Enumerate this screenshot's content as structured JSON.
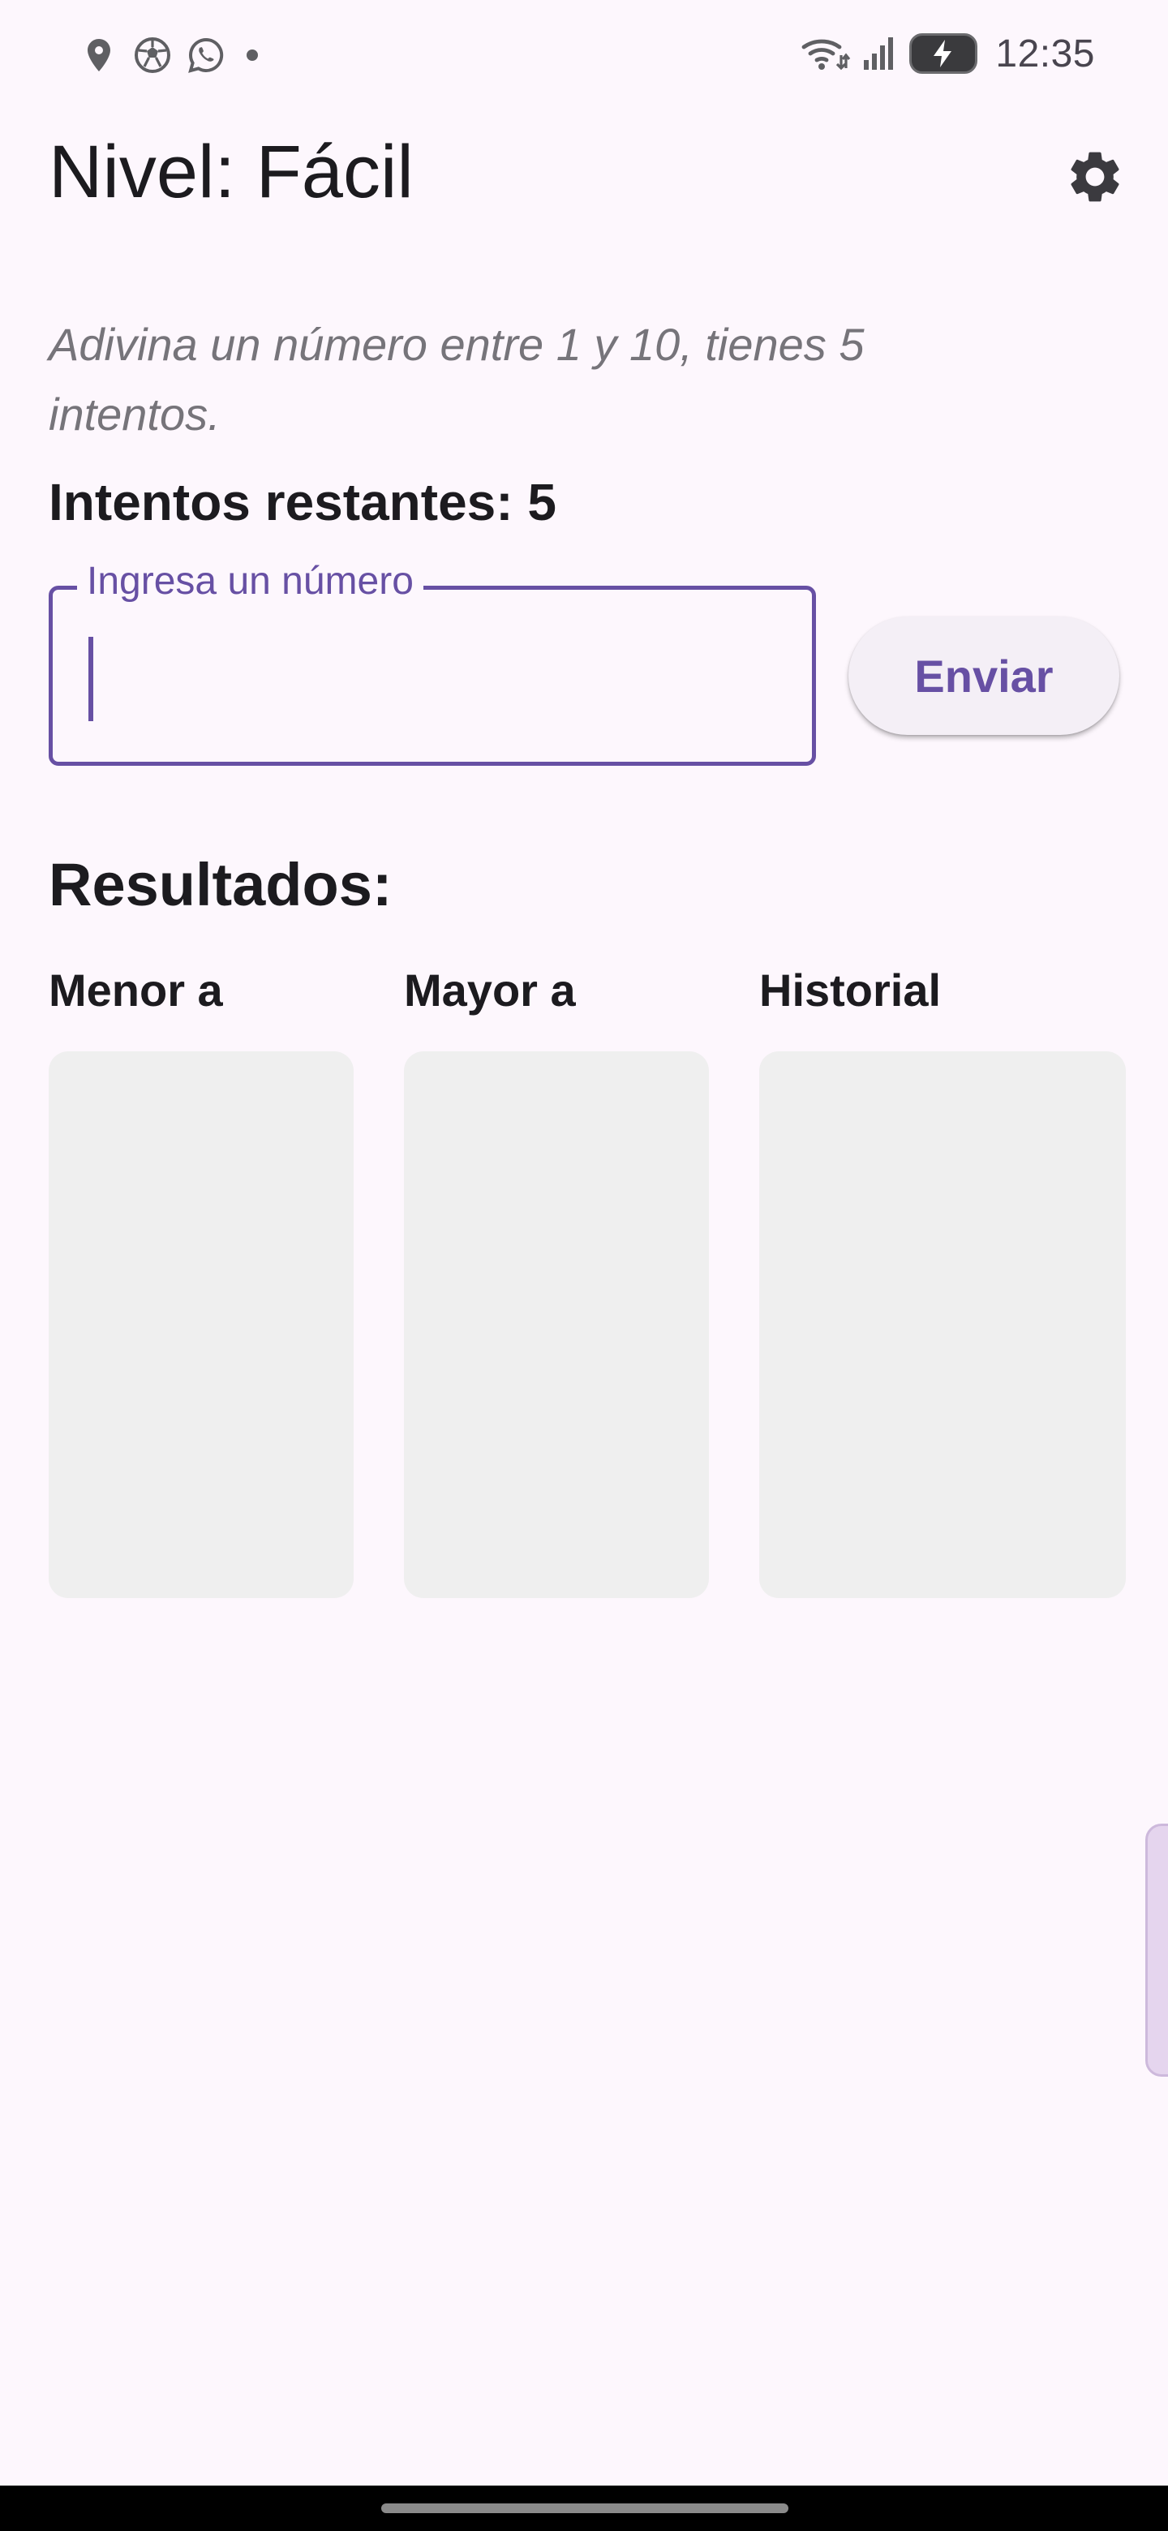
{
  "status_bar": {
    "time": "12:35",
    "left_icons": [
      "location-icon",
      "soccer-ball-icon",
      "whatsapp-icon",
      "notification-dot-icon"
    ],
    "right_icons": [
      "wifi-icon",
      "signal-icon",
      "battery-charging-icon"
    ]
  },
  "header": {
    "title": "Nivel: Fácil",
    "settings_icon": "gear-icon"
  },
  "game": {
    "instructions": "Adivina un número entre 1 y 10, tienes 5 intentos.",
    "attempts_label": "Intentos restantes: 5"
  },
  "input": {
    "label": "Ingresa un número",
    "value": ""
  },
  "send_button": {
    "label": "Enviar"
  },
  "results": {
    "heading": "Resultados:",
    "columns": [
      {
        "label": "Menor a"
      },
      {
        "label": "Mayor a"
      },
      {
        "label": "Historial"
      }
    ]
  },
  "colors": {
    "accent": "#6750a4",
    "background": "#fdf7fd",
    "panel": "#efefef"
  }
}
